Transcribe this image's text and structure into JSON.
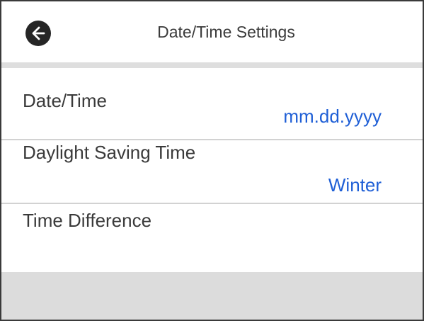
{
  "header": {
    "title": "Date/Time Settings",
    "back_icon": "arrow-left-icon"
  },
  "settings": [
    {
      "label": "Date/Time",
      "value": "mm.dd.yyyy"
    },
    {
      "label": "Daylight Saving Time",
      "value": "Winter"
    },
    {
      "label": "Time Difference",
      "value": ""
    }
  ],
  "colors": {
    "value_text": "#1f5fd6",
    "footer_bg": "#dcdcdc"
  }
}
